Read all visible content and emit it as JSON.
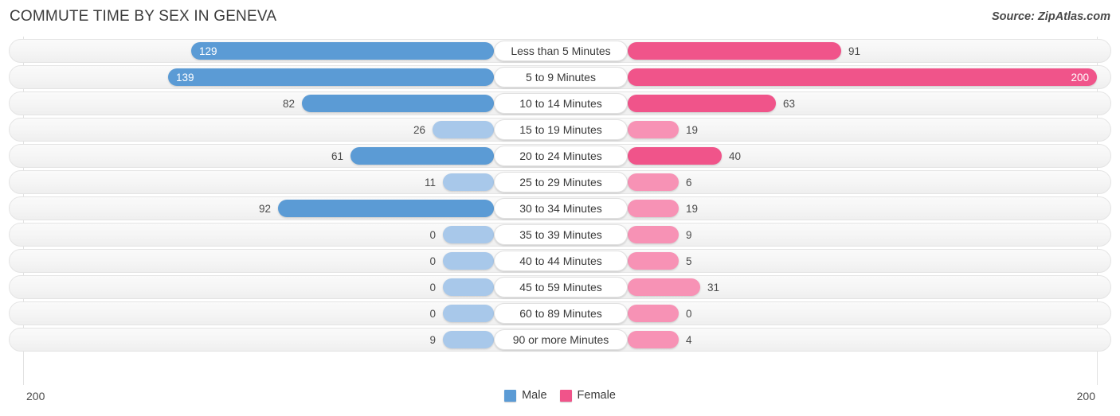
{
  "header": {
    "title": "COMMUTE TIME BY SEX IN GENEVA",
    "source": "Source: ZipAtlas.com"
  },
  "axis": {
    "min_label": "200",
    "max_label": "200"
  },
  "legend": {
    "items": [
      {
        "label": "Male",
        "color": "#5b9bd5"
      },
      {
        "label": "Female",
        "color": "#f0548a"
      }
    ]
  },
  "colors": {
    "male_strong": "#5b9bd5",
    "male_light": "#a8c8ea",
    "female_strong": "#f0548a",
    "female_light": "#f792b5",
    "track": "#f5f5f5",
    "gridline": "#e2e2e2"
  },
  "chart_data": {
    "type": "bar",
    "title": "COMMUTE TIME BY SEX IN GENEVA",
    "subtitle": "Source: ZipAtlas.com",
    "orientation": "horizontal-diverging",
    "xlabel": "",
    "ylabel": "",
    "xlim": [
      200,
      200
    ],
    "axis_max": 200,
    "grid": true,
    "legend_position": "bottom-center",
    "categories": [
      "Less than 5 Minutes",
      "5 to 9 Minutes",
      "10 to 14 Minutes",
      "15 to 19 Minutes",
      "20 to 24 Minutes",
      "25 to 29 Minutes",
      "30 to 34 Minutes",
      "35 to 39 Minutes",
      "40 to 44 Minutes",
      "45 to 59 Minutes",
      "60 to 89 Minutes",
      "90 or more Minutes"
    ],
    "series": [
      {
        "name": "Male",
        "color": "#5b9bd5",
        "side": "left",
        "values": [
          129,
          139,
          82,
          26,
          61,
          11,
          92,
          0,
          0,
          0,
          0,
          9
        ]
      },
      {
        "name": "Female",
        "color": "#f0548a",
        "side": "right",
        "values": [
          91,
          200,
          63,
          19,
          40,
          6,
          19,
          9,
          5,
          31,
          0,
          4
        ]
      }
    ]
  },
  "rows": [
    {
      "label": "Less than 5 Minutes",
      "male": "129",
      "female": "91"
    },
    {
      "label": "5 to 9 Minutes",
      "male": "139",
      "female": "200"
    },
    {
      "label": "10 to 14 Minutes",
      "male": "82",
      "female": "63"
    },
    {
      "label": "15 to 19 Minutes",
      "male": "26",
      "female": "19"
    },
    {
      "label": "20 to 24 Minutes",
      "male": "61",
      "female": "40"
    },
    {
      "label": "25 to 29 Minutes",
      "male": "11",
      "female": "6"
    },
    {
      "label": "30 to 34 Minutes",
      "male": "92",
      "female": "19"
    },
    {
      "label": "35 to 39 Minutes",
      "male": "0",
      "female": "9"
    },
    {
      "label": "40 to 44 Minutes",
      "male": "0",
      "female": "5"
    },
    {
      "label": "45 to 59 Minutes",
      "male": "0",
      "female": "31"
    },
    {
      "label": "60 to 89 Minutes",
      "male": "0",
      "female": "0"
    },
    {
      "label": "90 or more Minutes",
      "male": "9",
      "female": "4"
    }
  ]
}
